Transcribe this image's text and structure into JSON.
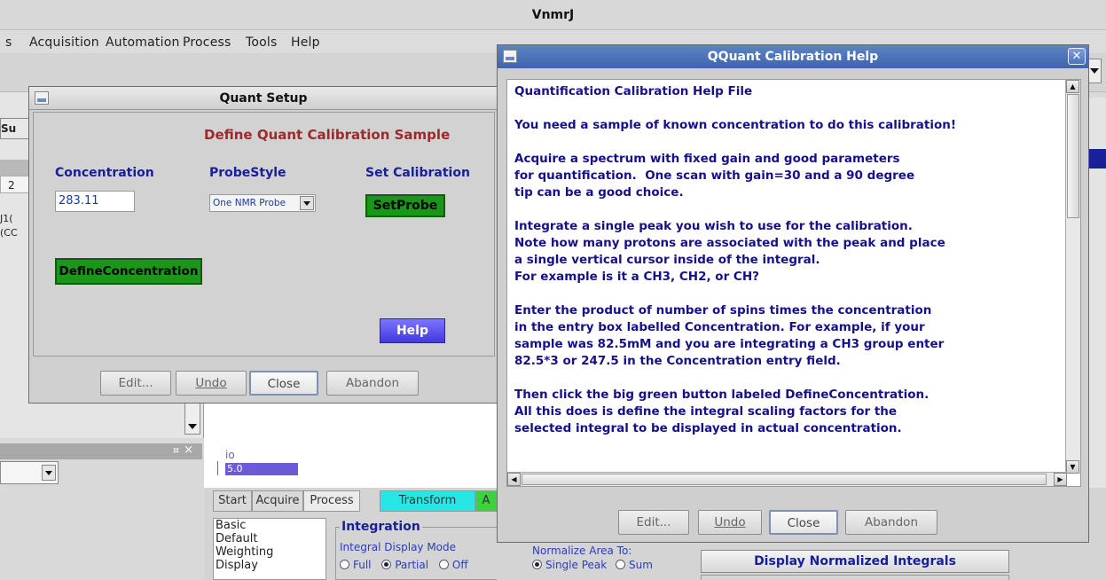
{
  "app": {
    "title": "VnmrJ"
  },
  "menu": [
    {
      "label": "s"
    },
    {
      "label": "Acquisition"
    },
    {
      "label": "Automation"
    },
    {
      "label": "Process"
    },
    {
      "label": "Tools"
    },
    {
      "label": "Help"
    }
  ],
  "left_panel": {
    "tab_fragments": [
      "Su",
      "2",
      "J1(",
      "(CC"
    ],
    "close_glyph": "×",
    "pin_glyph": "¤"
  },
  "quant_setup": {
    "title": "Quant Setup",
    "heading": "Define Quant Calibration Sample",
    "concentration_label": "Concentration",
    "concentration_value": "283.11",
    "probestyle_label": "ProbeStyle",
    "probestyle_value": "One NMR Probe",
    "set_calibration_label": "Set Calibration",
    "setprobe_button": "SetProbe",
    "define_button": "DefineConcentration",
    "help_button": "Help",
    "footer": {
      "edit": "Edit...",
      "undo": "Undo",
      "close": "Close",
      "abandon": "Abandon"
    }
  },
  "qquant_help": {
    "title": "QQuant Calibration Help",
    "lines": [
      "Quantification Calibration Help File",
      "",
      "You need a sample of known concentration to do this calibration!",
      "",
      "Acquire a spectrum with fixed gain and good parameters",
      "for quantification.  One scan with gain=30 and a 90 degree",
      "tip can be a good choice.",
      "",
      "Integrate a single peak you wish to use for the calibration.",
      "Note how many protons are associated with the peak and place",
      "a single vertical cursor inside of the integral.",
      "For example is it a CH3, CH2, or CH?",
      "",
      "Enter the product of number of spins times the concentration",
      "in the entry box labelled Concentration. For example, if your",
      "sample was 82.5mM and you are integrating a CH3 group enter",
      "82.5*3 or 247.5 in the Concentration entry field.",
      "",
      "Then click the big green button labeled DefineConcentration.",
      "All this does is define the integral scaling factors for the",
      "selected integral to be displayed in actual concentration."
    ],
    "footer": {
      "edit": "Edit...",
      "undo": "Undo",
      "close": "Close",
      "abandon": "Abandon"
    }
  },
  "graphics": {
    "io_label": "io",
    "io_value": "5.0"
  },
  "bottom_panel": {
    "tabs": [
      {
        "label": "Start"
      },
      {
        "label": "Acquire"
      },
      {
        "label": "Process"
      },
      {
        "label": "Transform"
      },
      {
        "label": "A"
      }
    ],
    "sidebar": [
      "Basic",
      "Default",
      "Weighting",
      "Display"
    ],
    "integration": {
      "title": "Integration",
      "mode_label": "Integral Display Mode",
      "options": [
        "Full",
        "Partial",
        "Off"
      ],
      "selected": "Partial"
    },
    "normalize": {
      "label": "Normalize Area To:",
      "options": [
        "Single Peak",
        "Sum"
      ],
      "selected": "Single Peak"
    },
    "display_normalized_button": "Display Normalized Integrals"
  },
  "colors": {
    "title_blue": "#3f64aa",
    "help_text": "#16108c",
    "heading_red": "#9b2a2a",
    "green_button": "#1a9618",
    "help_button": "#4338e0"
  }
}
